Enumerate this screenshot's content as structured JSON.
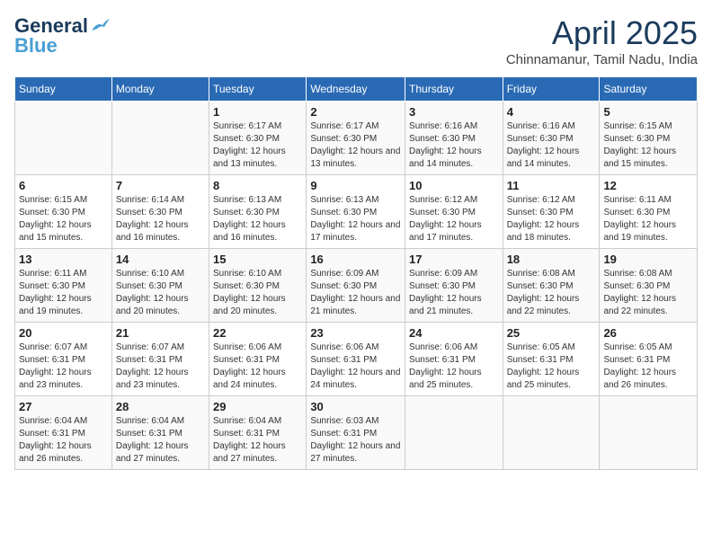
{
  "logo": {
    "line1": "General",
    "line2": "Blue"
  },
  "title": "April 2025",
  "location": "Chinnamanur, Tamil Nadu, India",
  "days_of_week": [
    "Sunday",
    "Monday",
    "Tuesday",
    "Wednesday",
    "Thursday",
    "Friday",
    "Saturday"
  ],
  "weeks": [
    [
      {
        "day": "",
        "sunrise": "",
        "sunset": "",
        "daylight": ""
      },
      {
        "day": "",
        "sunrise": "",
        "sunset": "",
        "daylight": ""
      },
      {
        "day": "1",
        "sunrise": "Sunrise: 6:17 AM",
        "sunset": "Sunset: 6:30 PM",
        "daylight": "Daylight: 12 hours and 13 minutes."
      },
      {
        "day": "2",
        "sunrise": "Sunrise: 6:17 AM",
        "sunset": "Sunset: 6:30 PM",
        "daylight": "Daylight: 12 hours and 13 minutes."
      },
      {
        "day": "3",
        "sunrise": "Sunrise: 6:16 AM",
        "sunset": "Sunset: 6:30 PM",
        "daylight": "Daylight: 12 hours and 14 minutes."
      },
      {
        "day": "4",
        "sunrise": "Sunrise: 6:16 AM",
        "sunset": "Sunset: 6:30 PM",
        "daylight": "Daylight: 12 hours and 14 minutes."
      },
      {
        "day": "5",
        "sunrise": "Sunrise: 6:15 AM",
        "sunset": "Sunset: 6:30 PM",
        "daylight": "Daylight: 12 hours and 15 minutes."
      }
    ],
    [
      {
        "day": "6",
        "sunrise": "Sunrise: 6:15 AM",
        "sunset": "Sunset: 6:30 PM",
        "daylight": "Daylight: 12 hours and 15 minutes."
      },
      {
        "day": "7",
        "sunrise": "Sunrise: 6:14 AM",
        "sunset": "Sunset: 6:30 PM",
        "daylight": "Daylight: 12 hours and 16 minutes."
      },
      {
        "day": "8",
        "sunrise": "Sunrise: 6:13 AM",
        "sunset": "Sunset: 6:30 PM",
        "daylight": "Daylight: 12 hours and 16 minutes."
      },
      {
        "day": "9",
        "sunrise": "Sunrise: 6:13 AM",
        "sunset": "Sunset: 6:30 PM",
        "daylight": "Daylight: 12 hours and 17 minutes."
      },
      {
        "day": "10",
        "sunrise": "Sunrise: 6:12 AM",
        "sunset": "Sunset: 6:30 PM",
        "daylight": "Daylight: 12 hours and 17 minutes."
      },
      {
        "day": "11",
        "sunrise": "Sunrise: 6:12 AM",
        "sunset": "Sunset: 6:30 PM",
        "daylight": "Daylight: 12 hours and 18 minutes."
      },
      {
        "day": "12",
        "sunrise": "Sunrise: 6:11 AM",
        "sunset": "Sunset: 6:30 PM",
        "daylight": "Daylight: 12 hours and 19 minutes."
      }
    ],
    [
      {
        "day": "13",
        "sunrise": "Sunrise: 6:11 AM",
        "sunset": "Sunset: 6:30 PM",
        "daylight": "Daylight: 12 hours and 19 minutes."
      },
      {
        "day": "14",
        "sunrise": "Sunrise: 6:10 AM",
        "sunset": "Sunset: 6:30 PM",
        "daylight": "Daylight: 12 hours and 20 minutes."
      },
      {
        "day": "15",
        "sunrise": "Sunrise: 6:10 AM",
        "sunset": "Sunset: 6:30 PM",
        "daylight": "Daylight: 12 hours and 20 minutes."
      },
      {
        "day": "16",
        "sunrise": "Sunrise: 6:09 AM",
        "sunset": "Sunset: 6:30 PM",
        "daylight": "Daylight: 12 hours and 21 minutes."
      },
      {
        "day": "17",
        "sunrise": "Sunrise: 6:09 AM",
        "sunset": "Sunset: 6:30 PM",
        "daylight": "Daylight: 12 hours and 21 minutes."
      },
      {
        "day": "18",
        "sunrise": "Sunrise: 6:08 AM",
        "sunset": "Sunset: 6:30 PM",
        "daylight": "Daylight: 12 hours and 22 minutes."
      },
      {
        "day": "19",
        "sunrise": "Sunrise: 6:08 AM",
        "sunset": "Sunset: 6:30 PM",
        "daylight": "Daylight: 12 hours and 22 minutes."
      }
    ],
    [
      {
        "day": "20",
        "sunrise": "Sunrise: 6:07 AM",
        "sunset": "Sunset: 6:31 PM",
        "daylight": "Daylight: 12 hours and 23 minutes."
      },
      {
        "day": "21",
        "sunrise": "Sunrise: 6:07 AM",
        "sunset": "Sunset: 6:31 PM",
        "daylight": "Daylight: 12 hours and 23 minutes."
      },
      {
        "day": "22",
        "sunrise": "Sunrise: 6:06 AM",
        "sunset": "Sunset: 6:31 PM",
        "daylight": "Daylight: 12 hours and 24 minutes."
      },
      {
        "day": "23",
        "sunrise": "Sunrise: 6:06 AM",
        "sunset": "Sunset: 6:31 PM",
        "daylight": "Daylight: 12 hours and 24 minutes."
      },
      {
        "day": "24",
        "sunrise": "Sunrise: 6:06 AM",
        "sunset": "Sunset: 6:31 PM",
        "daylight": "Daylight: 12 hours and 25 minutes."
      },
      {
        "day": "25",
        "sunrise": "Sunrise: 6:05 AM",
        "sunset": "Sunset: 6:31 PM",
        "daylight": "Daylight: 12 hours and 25 minutes."
      },
      {
        "day": "26",
        "sunrise": "Sunrise: 6:05 AM",
        "sunset": "Sunset: 6:31 PM",
        "daylight": "Daylight: 12 hours and 26 minutes."
      }
    ],
    [
      {
        "day": "27",
        "sunrise": "Sunrise: 6:04 AM",
        "sunset": "Sunset: 6:31 PM",
        "daylight": "Daylight: 12 hours and 26 minutes."
      },
      {
        "day": "28",
        "sunrise": "Sunrise: 6:04 AM",
        "sunset": "Sunset: 6:31 PM",
        "daylight": "Daylight: 12 hours and 27 minutes."
      },
      {
        "day": "29",
        "sunrise": "Sunrise: 6:04 AM",
        "sunset": "Sunset: 6:31 PM",
        "daylight": "Daylight: 12 hours and 27 minutes."
      },
      {
        "day": "30",
        "sunrise": "Sunrise: 6:03 AM",
        "sunset": "Sunset: 6:31 PM",
        "daylight": "Daylight: 12 hours and 27 minutes."
      },
      {
        "day": "",
        "sunrise": "",
        "sunset": "",
        "daylight": ""
      },
      {
        "day": "",
        "sunrise": "",
        "sunset": "",
        "daylight": ""
      },
      {
        "day": "",
        "sunrise": "",
        "sunset": "",
        "daylight": ""
      }
    ]
  ]
}
